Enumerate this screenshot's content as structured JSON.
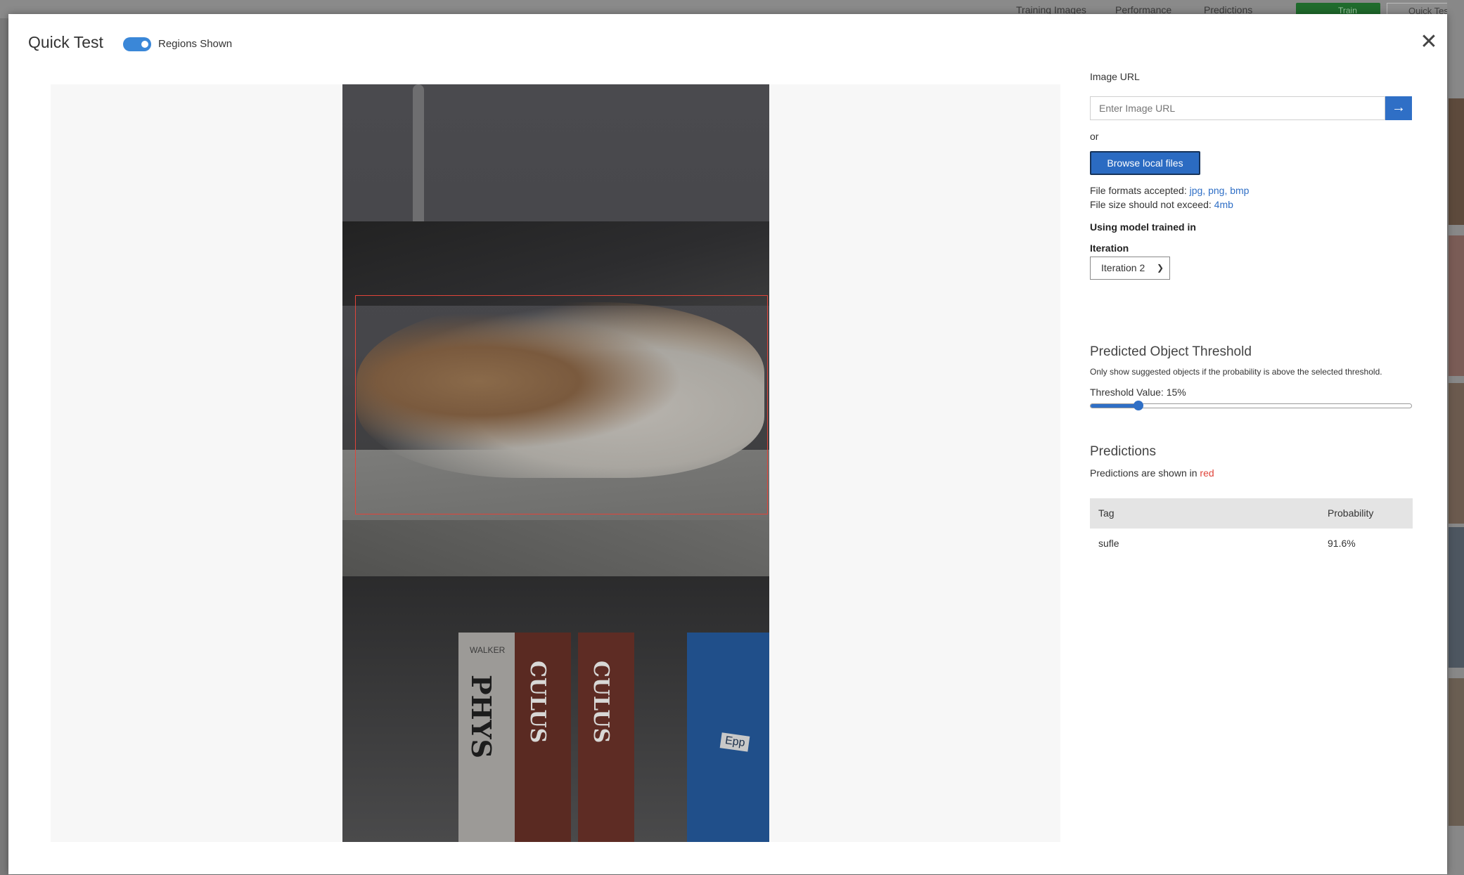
{
  "background": {
    "nav": [
      "Training Images",
      "Performance",
      "Predictions"
    ],
    "train_label": "Train",
    "quick_test_label": "Quick Test"
  },
  "modal": {
    "title": "Quick Test",
    "regions_toggle": {
      "label": "Regions Shown",
      "on": true
    },
    "close_icon": "close-icon"
  },
  "image": {
    "region_color": "#e0443a",
    "book_spine_texts": [
      "WALKER",
      "PHYS",
      "CULUS",
      "CULUS",
      "Epp"
    ]
  },
  "panel": {
    "image_url_label": "Image URL",
    "image_url_placeholder": "Enter Image URL",
    "go_icon": "arrow-right-icon",
    "or_text": "or",
    "browse_button": "Browse local files",
    "formats_prefix": "File formats accepted:",
    "formats_value": "jpg, png, bmp",
    "size_prefix": "File size should not exceed:",
    "size_value": "4mb",
    "model_heading": "Using model trained in",
    "iteration_label": "Iteration",
    "iteration_selected": "Iteration 2",
    "threshold_heading": "Predicted Object Threshold",
    "threshold_desc": "Only show suggested objects if the probability is above the selected threshold.",
    "threshold_label": "Threshold Value: 15%",
    "threshold_value": 0.15,
    "predictions_heading": "Predictions",
    "predictions_note_prefix": "Predictions are shown in",
    "predictions_note_color": "red",
    "table": {
      "headers": [
        "Tag",
        "Probability"
      ],
      "rows": [
        {
          "tag": "sufle",
          "probability": "91.6%"
        }
      ]
    }
  }
}
